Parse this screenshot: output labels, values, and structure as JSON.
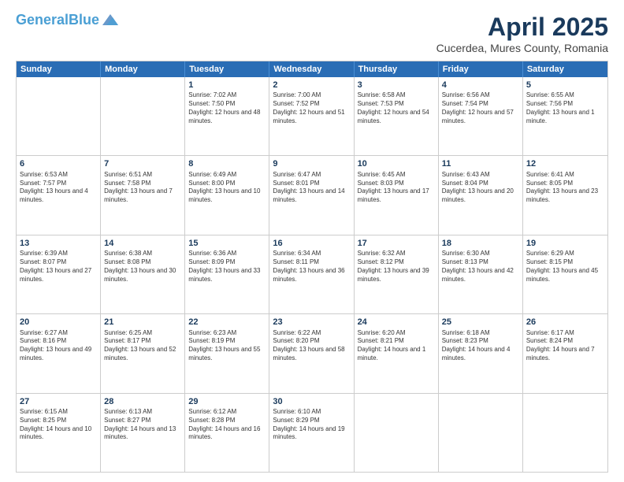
{
  "logo": {
    "general": "General",
    "blue": "Blue"
  },
  "title": "April 2025",
  "subtitle": "Cucerdea, Mures County, Romania",
  "days": [
    "Sunday",
    "Monday",
    "Tuesday",
    "Wednesday",
    "Thursday",
    "Friday",
    "Saturday"
  ],
  "weeks": [
    [
      {
        "num": "",
        "info": ""
      },
      {
        "num": "",
        "info": ""
      },
      {
        "num": "1",
        "info": "Sunrise: 7:02 AM\nSunset: 7:50 PM\nDaylight: 12 hours and 48 minutes."
      },
      {
        "num": "2",
        "info": "Sunrise: 7:00 AM\nSunset: 7:52 PM\nDaylight: 12 hours and 51 minutes."
      },
      {
        "num": "3",
        "info": "Sunrise: 6:58 AM\nSunset: 7:53 PM\nDaylight: 12 hours and 54 minutes."
      },
      {
        "num": "4",
        "info": "Sunrise: 6:56 AM\nSunset: 7:54 PM\nDaylight: 12 hours and 57 minutes."
      },
      {
        "num": "5",
        "info": "Sunrise: 6:55 AM\nSunset: 7:56 PM\nDaylight: 13 hours and 1 minute."
      }
    ],
    [
      {
        "num": "6",
        "info": "Sunrise: 6:53 AM\nSunset: 7:57 PM\nDaylight: 13 hours and 4 minutes."
      },
      {
        "num": "7",
        "info": "Sunrise: 6:51 AM\nSunset: 7:58 PM\nDaylight: 13 hours and 7 minutes."
      },
      {
        "num": "8",
        "info": "Sunrise: 6:49 AM\nSunset: 8:00 PM\nDaylight: 13 hours and 10 minutes."
      },
      {
        "num": "9",
        "info": "Sunrise: 6:47 AM\nSunset: 8:01 PM\nDaylight: 13 hours and 14 minutes."
      },
      {
        "num": "10",
        "info": "Sunrise: 6:45 AM\nSunset: 8:03 PM\nDaylight: 13 hours and 17 minutes."
      },
      {
        "num": "11",
        "info": "Sunrise: 6:43 AM\nSunset: 8:04 PM\nDaylight: 13 hours and 20 minutes."
      },
      {
        "num": "12",
        "info": "Sunrise: 6:41 AM\nSunset: 8:05 PM\nDaylight: 13 hours and 23 minutes."
      }
    ],
    [
      {
        "num": "13",
        "info": "Sunrise: 6:39 AM\nSunset: 8:07 PM\nDaylight: 13 hours and 27 minutes."
      },
      {
        "num": "14",
        "info": "Sunrise: 6:38 AM\nSunset: 8:08 PM\nDaylight: 13 hours and 30 minutes."
      },
      {
        "num": "15",
        "info": "Sunrise: 6:36 AM\nSunset: 8:09 PM\nDaylight: 13 hours and 33 minutes."
      },
      {
        "num": "16",
        "info": "Sunrise: 6:34 AM\nSunset: 8:11 PM\nDaylight: 13 hours and 36 minutes."
      },
      {
        "num": "17",
        "info": "Sunrise: 6:32 AM\nSunset: 8:12 PM\nDaylight: 13 hours and 39 minutes."
      },
      {
        "num": "18",
        "info": "Sunrise: 6:30 AM\nSunset: 8:13 PM\nDaylight: 13 hours and 42 minutes."
      },
      {
        "num": "19",
        "info": "Sunrise: 6:29 AM\nSunset: 8:15 PM\nDaylight: 13 hours and 45 minutes."
      }
    ],
    [
      {
        "num": "20",
        "info": "Sunrise: 6:27 AM\nSunset: 8:16 PM\nDaylight: 13 hours and 49 minutes."
      },
      {
        "num": "21",
        "info": "Sunrise: 6:25 AM\nSunset: 8:17 PM\nDaylight: 13 hours and 52 minutes."
      },
      {
        "num": "22",
        "info": "Sunrise: 6:23 AM\nSunset: 8:19 PM\nDaylight: 13 hours and 55 minutes."
      },
      {
        "num": "23",
        "info": "Sunrise: 6:22 AM\nSunset: 8:20 PM\nDaylight: 13 hours and 58 minutes."
      },
      {
        "num": "24",
        "info": "Sunrise: 6:20 AM\nSunset: 8:21 PM\nDaylight: 14 hours and 1 minute."
      },
      {
        "num": "25",
        "info": "Sunrise: 6:18 AM\nSunset: 8:23 PM\nDaylight: 14 hours and 4 minutes."
      },
      {
        "num": "26",
        "info": "Sunrise: 6:17 AM\nSunset: 8:24 PM\nDaylight: 14 hours and 7 minutes."
      }
    ],
    [
      {
        "num": "27",
        "info": "Sunrise: 6:15 AM\nSunset: 8:25 PM\nDaylight: 14 hours and 10 minutes."
      },
      {
        "num": "28",
        "info": "Sunrise: 6:13 AM\nSunset: 8:27 PM\nDaylight: 14 hours and 13 minutes."
      },
      {
        "num": "29",
        "info": "Sunrise: 6:12 AM\nSunset: 8:28 PM\nDaylight: 14 hours and 16 minutes."
      },
      {
        "num": "30",
        "info": "Sunrise: 6:10 AM\nSunset: 8:29 PM\nDaylight: 14 hours and 19 minutes."
      },
      {
        "num": "",
        "info": ""
      },
      {
        "num": "",
        "info": ""
      },
      {
        "num": "",
        "info": ""
      }
    ]
  ]
}
